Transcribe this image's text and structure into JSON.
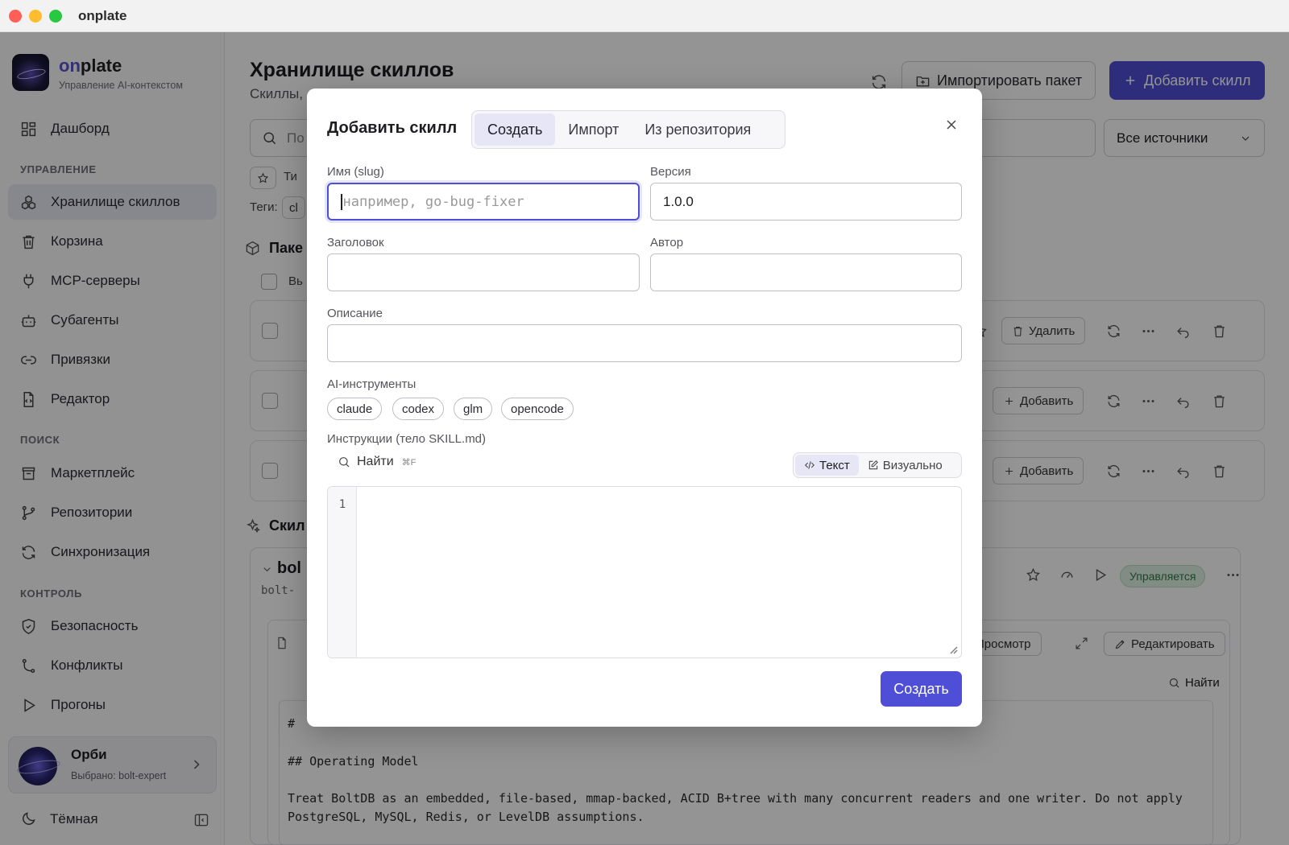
{
  "window": {
    "title": "onplate"
  },
  "brand": {
    "name_prefix": "on",
    "name_suffix": "plate",
    "subtitle": "Управление AI-контекстом"
  },
  "sidebar": {
    "dashboard": "Дашборд",
    "sections": {
      "manage": "УПРАВЛЕНИЕ",
      "search": "ПОИСК",
      "control": "КОНТРОЛЬ"
    },
    "items": {
      "skills": "Хранилище скиллов",
      "trash": "Корзина",
      "mcp": "MCP-серверы",
      "subagents": "Субагенты",
      "bindings": "Привязки",
      "editor": "Редактор",
      "marketplace": "Маркетплейс",
      "repos": "Репозитории",
      "sync": "Синхронизация",
      "security": "Безопасность",
      "conflicts": "Конфликты",
      "runs": "Прогоны"
    },
    "orbi": {
      "name": "Орби",
      "selected": "Выбрано: bolt-expert"
    },
    "theme": "Тёмная"
  },
  "main": {
    "title": "Хранилище скиллов",
    "subtitle": "Скиллы,",
    "import_button": "Импортировать пакет",
    "add_button": "Добавить скилл",
    "search_placeholder": "По",
    "sources_select": "Все источники",
    "filter_label": "Ти",
    "tags_label": "Теги:",
    "tag_chip": "cl",
    "packs_heading": "Паке",
    "select_all": "Вь",
    "row_buttons": {
      "delete": "Удалить",
      "add": "Добавить"
    },
    "skills_heading": "Скил",
    "skill_name": "bol",
    "skill_slug": "bolt-",
    "managed_badge": "Управляется",
    "view_button": "Просмотр",
    "edit_button": "Редактировать",
    "find_button": "Найти",
    "code_lines": [
      "#",
      "## Operating Model",
      "Treat BoltDB as an embedded, file-based, mmap-backed, ACID B+tree with many concurrent readers and one writer. Do not apply",
      "PostgreSQL, MySQL, Redis, or LevelDB assumptions."
    ]
  },
  "modal": {
    "title": "Добавить скилл",
    "tabs": [
      "Создать",
      "Импорт",
      "Из репозитория"
    ],
    "fields": {
      "name_label": "Имя (slug)",
      "name_placeholder": "например, go-bug-fixer",
      "version_label": "Версия",
      "version_value": "1.0.0",
      "heading_label": "Заголовок",
      "author_label": "Автор",
      "description_label": "Описание"
    },
    "ai_tools_label": "AI-инструменты",
    "ai_tools": [
      "claude",
      "codex",
      "glm",
      "opencode"
    ],
    "instructions_label": "Инструкции (тело SKILL.md)",
    "find_label": "Найти",
    "find_shortcut": "⌘F",
    "modes": [
      "Текст",
      "Визуально"
    ],
    "line_number": "1",
    "submit": "Создать"
  },
  "colors": {
    "accent": "#4e4ed6",
    "overlay": "rgba(0,0,0,0.42)",
    "managed_bg": "#dff1e3"
  }
}
